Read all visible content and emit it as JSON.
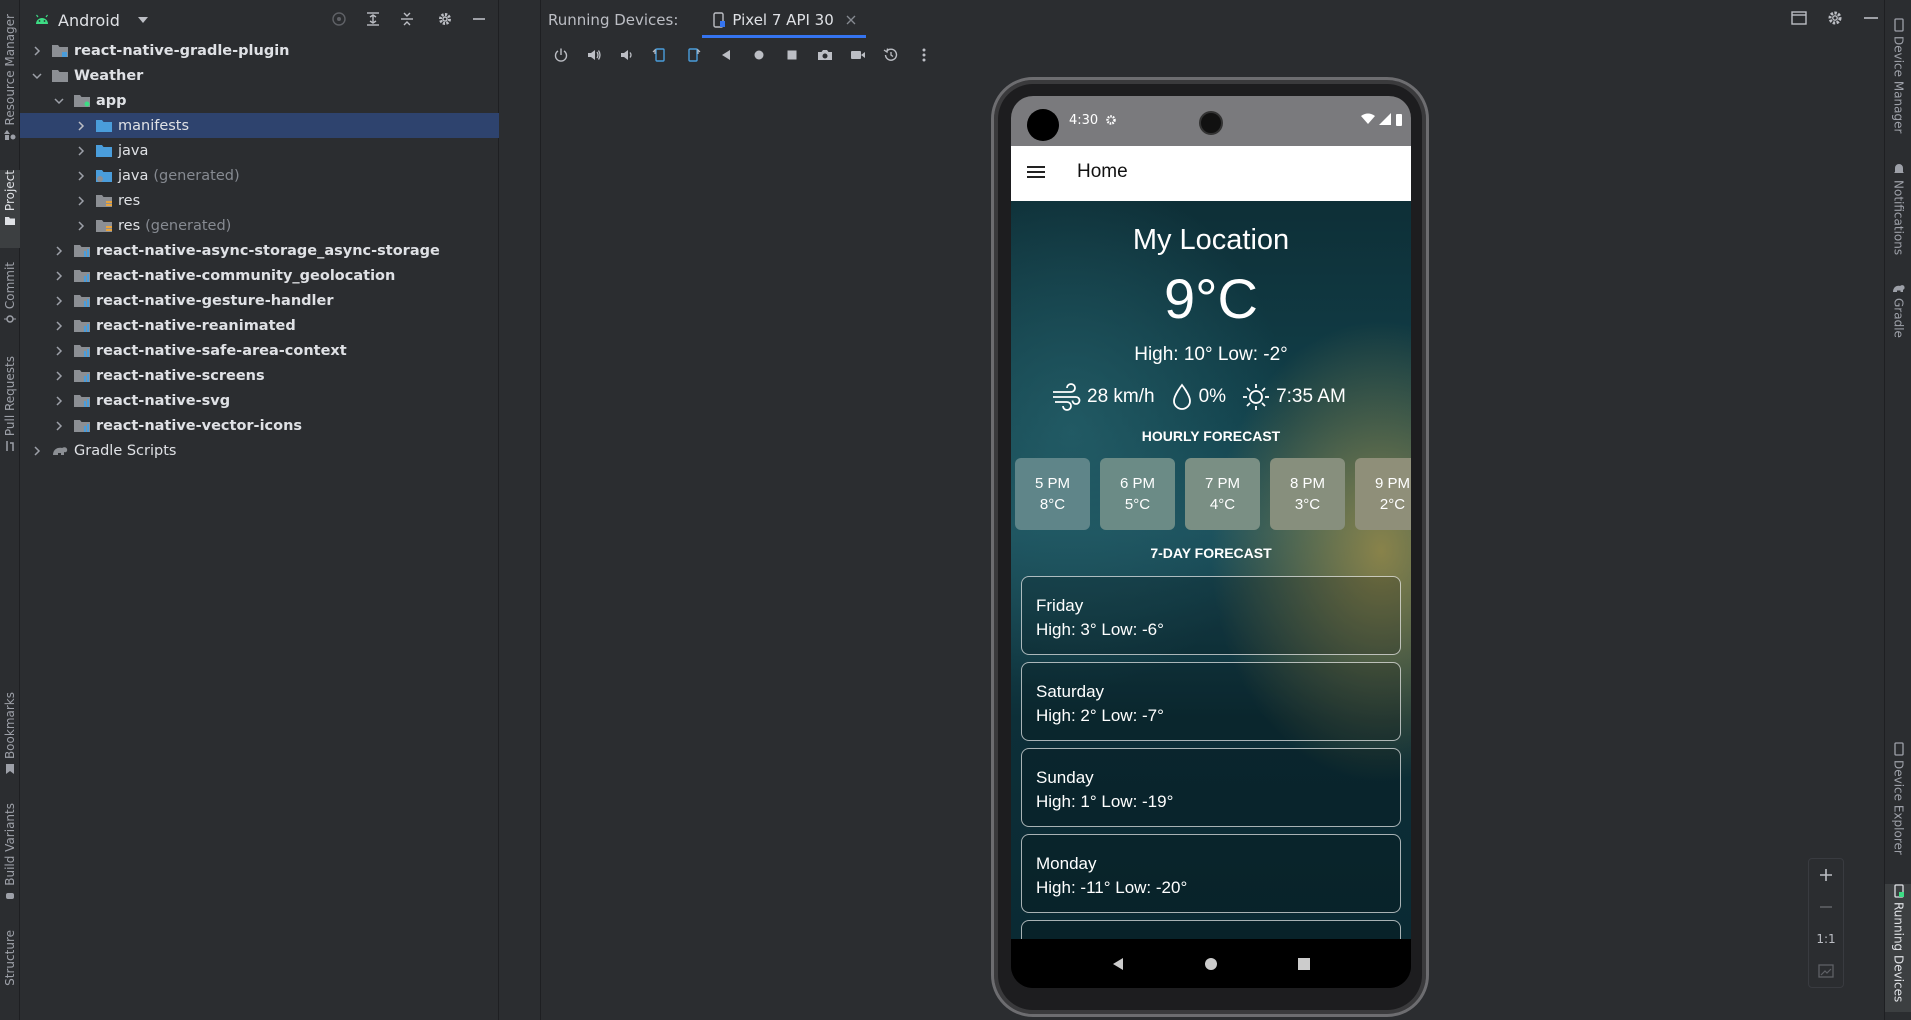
{
  "project_panel": {
    "view_name": "Android",
    "tree": [
      {
        "label": "react-native-gradle-plugin",
        "bold": true,
        "suffix": "",
        "depth": 0,
        "expanded": false,
        "icon": "module-folder-icon"
      },
      {
        "label": "Weather",
        "bold": true,
        "suffix": "",
        "depth": 0,
        "expanded": true,
        "icon": "module-folder-icon"
      },
      {
        "label": "app",
        "bold": true,
        "suffix": "",
        "depth": 1,
        "expanded": true,
        "icon": "app-module-icon"
      },
      {
        "label": "manifests",
        "bold": false,
        "suffix": "",
        "depth": 2,
        "expanded": false,
        "icon": "folder-icon",
        "selected": true
      },
      {
        "label": "java",
        "bold": false,
        "suffix": "",
        "depth": 2,
        "expanded": false,
        "icon": "folder-icon"
      },
      {
        "label": "java",
        "bold": false,
        "suffix": "(generated)",
        "depth": 2,
        "expanded": false,
        "icon": "generated-folder-icon"
      },
      {
        "label": "res",
        "bold": false,
        "suffix": "",
        "depth": 2,
        "expanded": false,
        "icon": "res-folder-icon"
      },
      {
        "label": "res",
        "bold": false,
        "suffix": "(generated)",
        "depth": 2,
        "expanded": false,
        "icon": "res-folder-icon"
      },
      {
        "label": "react-native-async-storage_async-storage",
        "bold": true,
        "suffix": "",
        "depth": 1,
        "expanded": false,
        "icon": "library-module-icon"
      },
      {
        "label": "react-native-community_geolocation",
        "bold": true,
        "suffix": "",
        "depth": 1,
        "expanded": false,
        "icon": "library-module-icon"
      },
      {
        "label": "react-native-gesture-handler",
        "bold": true,
        "suffix": "",
        "depth": 1,
        "expanded": false,
        "icon": "library-module-icon"
      },
      {
        "label": "react-native-reanimated",
        "bold": true,
        "suffix": "",
        "depth": 1,
        "expanded": false,
        "icon": "library-module-icon"
      },
      {
        "label": "react-native-safe-area-context",
        "bold": true,
        "suffix": "",
        "depth": 1,
        "expanded": false,
        "icon": "library-module-icon"
      },
      {
        "label": "react-native-screens",
        "bold": true,
        "suffix": "",
        "depth": 1,
        "expanded": false,
        "icon": "library-module-icon"
      },
      {
        "label": "react-native-svg",
        "bold": true,
        "suffix": "",
        "depth": 1,
        "expanded": false,
        "icon": "library-module-icon"
      },
      {
        "label": "react-native-vector-icons",
        "bold": true,
        "suffix": "",
        "depth": 1,
        "expanded": false,
        "icon": "library-module-icon"
      },
      {
        "label": "Gradle Scripts",
        "bold": false,
        "suffix": "",
        "depth": 0,
        "expanded": false,
        "icon": "gradle-icon"
      }
    ]
  },
  "left_tabs": {
    "resource_manager": "Resource Manager",
    "project": "Project",
    "commit": "Commit",
    "pull_requests": "Pull Requests",
    "bookmarks": "Bookmarks",
    "build_variants": "Build Variants",
    "structure": "Structure"
  },
  "right_tabs": {
    "device_manager": "Device Manager",
    "notifications": "Notifications",
    "gradle": "Gradle",
    "device_explorer": "Device Explorer",
    "running_devices": "Running Devices"
  },
  "running_devices": {
    "title": "Running Devices:",
    "device_tab": "Pixel 7 API 30",
    "zoom_actual": "1:1"
  },
  "phone": {
    "status_time": "4:30",
    "app_title": "Home",
    "location": "My Location",
    "temperature": "9°C",
    "high_low": "High: 10°   Low: -2°",
    "wind": "28 km/h",
    "precipitation": "0%",
    "sunrise": "7:35 AM",
    "hourly_title": "HOURLY FORECAST",
    "hourly": [
      {
        "time": "5 PM",
        "temp": "8°C",
        "bg": "#5f8589"
      },
      {
        "time": "6 PM",
        "temp": "5°C",
        "bg": "#6b8b86"
      },
      {
        "time": "7 PM",
        "temp": "4°C",
        "bg": "#7a8f84"
      },
      {
        "time": "8 PM",
        "temp": "3°C",
        "bg": "#878f7d"
      },
      {
        "time": "9 PM",
        "temp": "2°C",
        "bg": "#8f8f79"
      }
    ],
    "daily_title": "7-DAY FORECAST",
    "daily": [
      {
        "day": "Friday",
        "hilo": "High: 3° Low: -6°"
      },
      {
        "day": "Saturday",
        "hilo": "High: 2° Low: -7°"
      },
      {
        "day": "Sunday",
        "hilo": "High: 1° Low: -19°"
      },
      {
        "day": "Monday",
        "hilo": "High: -11° Low: -20°"
      }
    ]
  },
  "colors": {
    "ide_bg": "#2b2d30",
    "selection": "#2e436e",
    "accent": "#3574f0",
    "folder": "#4a9ddb"
  }
}
